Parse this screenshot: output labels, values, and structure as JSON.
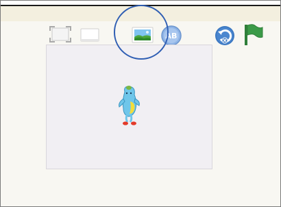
{
  "toolbar": {
    "buttons": [
      {
        "name": "fullscreen-button",
        "icon": "fullscreen-corners-icon"
      },
      {
        "name": "presentation-button",
        "icon": "white-rectangle-icon"
      },
      {
        "name": "background-button",
        "icon": "landscape-picture-icon"
      },
      {
        "name": "text-button",
        "icon": "ab-text-icon"
      },
      {
        "name": "reset-button",
        "icon": "reset-arrow-icon"
      },
      {
        "name": "green-flag-button",
        "icon": "green-flag-icon"
      }
    ]
  },
  "text_button": {
    "label": "AB"
  },
  "stage": {
    "background_color": "#f1eff3",
    "sprite": {
      "name": "blue-bird-character"
    }
  },
  "annotation": {
    "color": "#2f5eb3",
    "target": "background-button"
  },
  "colors": {
    "toolbar_band": "#f3efdf",
    "reset_blue": "#3d79c2",
    "flag_green": "#3b9a48",
    "character_blue": "#6fc6ea",
    "character_belly": "#f3dd3a",
    "character_feet": "#e33b2a"
  }
}
